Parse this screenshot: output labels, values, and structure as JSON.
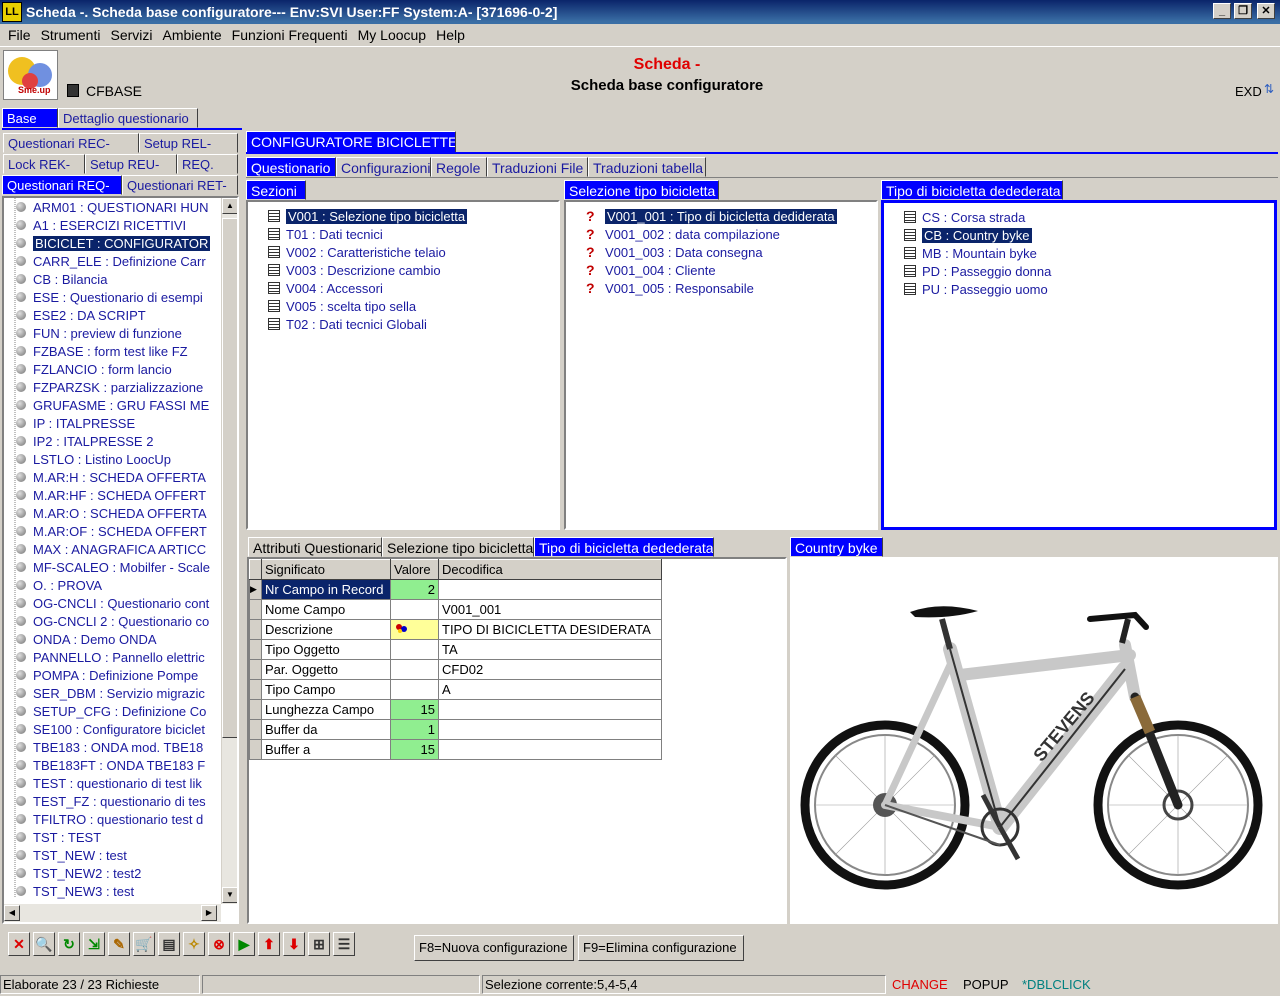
{
  "window": {
    "title": "Scheda -. Scheda base configuratore--- Env:SVI User:FF System:A- [371696-0-2]",
    "app_icon": "LL",
    "min": "_",
    "restore": "❐",
    "close": "✕"
  },
  "menu": [
    "File",
    "Strumenti",
    "Servizi",
    "Ambiente",
    "Funzioni Frequenti",
    "My Loocup",
    "Help"
  ],
  "header": {
    "code": "CFBASE",
    "title_red": "Scheda -",
    "title_black": "Scheda base configuratore",
    "exd": "EXD",
    "logo_text": "Sme.up"
  },
  "left_tabs": {
    "row0": [
      "Base",
      "Dettaglio questionario"
    ],
    "row1": [
      "Questionari REC-",
      "Setup REL-"
    ],
    "row2": [
      "Lock REK-",
      "Setup REU-",
      "REQ."
    ],
    "row3": [
      "Questionari REQ-",
      "Questionari RET-"
    ]
  },
  "left_list": [
    "ARM01 : QUESTIONARI HUN",
    "A1 : ESERCIZI RICETTIVI",
    "BICICLET : CONFIGURATOR",
    "CARR_ELE : Definizione Carr",
    "CB : Bilancia",
    "ESE : Questionario di esempi",
    "ESE2 : DA SCRIPT",
    "FUN : preview di funzione",
    "FZBASE : form test like FZ",
    "FZLANCIO : form lancio",
    "FZPARZSK : parzializzazione",
    "GRUFASME : GRU FASSI ME",
    "IP : ITALPRESSE",
    "IP2 : ITALPRESSE 2",
    "LSTLO : Listino LoocUp",
    "M.AR:H : SCHEDA OFFERTA",
    "M.AR:HF : SCHEDA OFFERT",
    "M.AR:O : SCHEDA OFFERTA",
    "M.AR:OF : SCHEDA OFFERT",
    "MAX : ANAGRAFICA ARTICC",
    "MF-SCALEO : Mobilfer - Scale",
    "O. : PROVA",
    "OG-CNCLI : Questionario cont",
    "OG-CNCLI 2 : Questionario co",
    "ONDA : Demo ONDA",
    "PANNELLO : Pannello elettric",
    "POMPA : Definizione Pompe",
    "SER_DBM : Servizio migrazic",
    "SETUP_CFG : Definizione Co",
    "SE100 : Configuratore biciclet",
    "TBE183 : ONDA mod. TBE18",
    "TBE183FT : ONDA TBE183 F",
    "TEST : questionario di test lik",
    "TEST_FZ : questionario di tes",
    "TFILTRO : questionario test d",
    "TST : TEST",
    "TST_NEW : test",
    "TST_NEW2 : test2",
    "TST_NEW3 : test"
  ],
  "main_tab": "CONFIGURATORE BICICLETTE",
  "sub_tabs": [
    "Questionario",
    "Configurazioni",
    "Regole",
    "Traduzioni File",
    "Traduzioni tabella"
  ],
  "sezioni": {
    "title": "Sezioni",
    "items": [
      "V001 : Selezione tipo bicicletta",
      "T01 : Dati tecnici",
      "V002 : Caratteristiche telaio",
      "V003 : Descrizione cambio",
      "V004 : Accessori",
      "V005 : scelta tipo sella",
      "T02 : Dati tecnici Globali"
    ]
  },
  "selezione": {
    "title": "Selezione tipo bicicletta",
    "items": [
      "V001_001 : Tipo di bicicletta dediderata",
      "V001_002 : data compilazione",
      "V001_003 : Data consegna",
      "V001_004 : Cliente",
      "V001_005 : Responsabile"
    ]
  },
  "tipo": {
    "title": "Tipo di bicicletta dedederata",
    "items": [
      "CS : Corsa strada",
      "CB : Country byke",
      "MB : Mountain byke",
      "PD : Passeggio donna",
      "PU : Passeggio uomo"
    ]
  },
  "bottom_tabs": [
    "Attributi Questionario",
    "Selezione tipo bicicletta",
    "Tipo di bicicletta dedederata"
  ],
  "grid": {
    "headers": [
      "Significato",
      "Valore",
      "Decodifica"
    ],
    "rows": [
      {
        "sig": "Nr Campo in Record",
        "val": "2",
        "dec": ""
      },
      {
        "sig": "Nome Campo",
        "val": "",
        "dec": "V001_001"
      },
      {
        "sig": "Descrizione",
        "val": "",
        "dec": "TIPO DI BICICLETTA DESIDERATA"
      },
      {
        "sig": "Tipo Oggetto",
        "val": "",
        "dec": "TA"
      },
      {
        "sig": "Par. Oggetto",
        "val": "",
        "dec": "CFD02"
      },
      {
        "sig": "Tipo Campo",
        "val": "",
        "dec": "A"
      },
      {
        "sig": "Lunghezza Campo",
        "val": "15",
        "dec": ""
      },
      {
        "sig": "Buffer da",
        "val": "1",
        "dec": ""
      },
      {
        "sig": "Buffer a",
        "val": "15",
        "dec": ""
      }
    ]
  },
  "image_tab": "Country byke",
  "bike_brand": "STEVENS",
  "toolbar_icons": [
    "close-icon",
    "search-icon",
    "refresh-icon",
    "export-icon",
    "edit-icon",
    "cart-icon",
    "print-icon",
    "find-icon",
    "stop-icon",
    "play-icon",
    "up-icon",
    "down-icon",
    "tree-icon",
    "list-icon"
  ],
  "toolbar_glyphs": [
    "✕",
    "🔍",
    "↻",
    "⇲",
    "✎",
    "🛒",
    "▤",
    "✧",
    "⊗",
    "▶",
    "⬆",
    "⬇",
    "⊞",
    "☰"
  ],
  "fbuttons": [
    "F8=Nuova configurazione",
    "F9=Elimina configurazione"
  ],
  "status": {
    "left": "Elaborate 23 / 23 Richieste",
    "mid": "Selezione corrente:5,4-5,4",
    "change": "CHANGE",
    "popup": "POPUP",
    "dbl": "*DBLCLICK"
  },
  "colors": {
    "accent": "#0000ff",
    "selection": "#0a246a",
    "valore": "#90ee90",
    "status_red": "#e00000",
    "status_teal": "#008080"
  }
}
